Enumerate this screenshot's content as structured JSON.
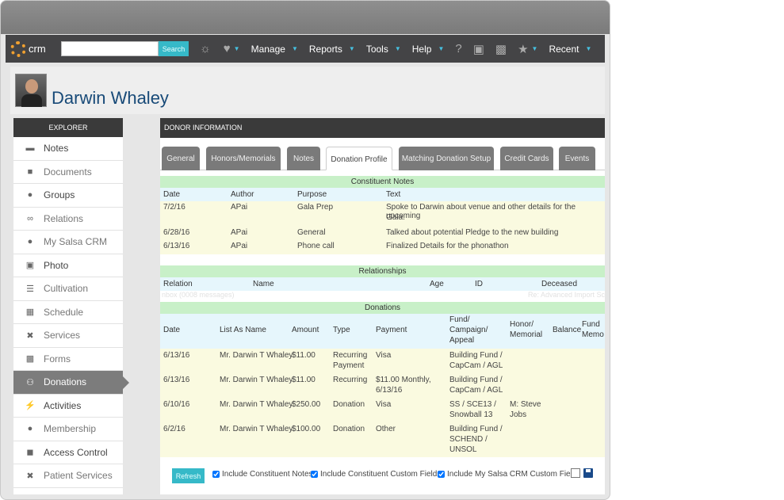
{
  "nav": {
    "logo_text": "crm",
    "search_placeholder": "",
    "search_button": "Search",
    "items": [
      "Manage",
      "Reports",
      "Tools",
      "Help",
      "Recent"
    ]
  },
  "person": {
    "name": "Darwin Whaley"
  },
  "explorer": {
    "title": "EXPLORER",
    "items": [
      {
        "label": "Notes",
        "icon": "notes-icon"
      },
      {
        "label": "Documents",
        "icon": "folder-icon"
      },
      {
        "label": "Groups",
        "icon": "groups-icon"
      },
      {
        "label": "Relations",
        "icon": "link-icon"
      },
      {
        "label": "My Salsa CRM",
        "icon": "user-settings-icon"
      },
      {
        "label": "Photo",
        "icon": "photo-icon"
      },
      {
        "label": "Cultivation",
        "icon": "cultivation-icon"
      },
      {
        "label": "Schedule",
        "icon": "calendar-icon"
      },
      {
        "label": "Services",
        "icon": "tools-icon"
      },
      {
        "label": "Forms",
        "icon": "forms-icon"
      },
      {
        "label": "Donations",
        "icon": "donations-icon"
      },
      {
        "label": "Activities",
        "icon": "bolt-icon"
      },
      {
        "label": "Membership",
        "icon": "membership-icon"
      },
      {
        "label": "Access Control",
        "icon": "lock-icon"
      },
      {
        "label": "Patient Services",
        "icon": "tools-icon"
      }
    ]
  },
  "main": {
    "title": "DONOR INFORMATION",
    "tabs": [
      "General",
      "Honors/Memorials",
      "Notes",
      "Donation Profile",
      "Matching Donation Setup",
      "Credit Cards",
      "Events"
    ],
    "active_tab": "Donation Profile"
  },
  "constituent_notes": {
    "title": "Constituent Notes",
    "headers": [
      "Date",
      "Author",
      "Purpose",
      "Text"
    ],
    "rows": [
      [
        "7/2/16",
        "APai",
        "Gala Prep",
        "Spoke to Darwin about venue and other details for the upcoming",
        "Gala."
      ],
      [
        "6/28/16",
        "APai",
        "General",
        "Talked about potential Pledge to the new building",
        ""
      ],
      [
        "6/13/16",
        "APai",
        "Phone call",
        "Finalized Details for the phonathon",
        ""
      ]
    ]
  },
  "relationships": {
    "title": "Relationships",
    "headers": [
      "Relation",
      "Name",
      "Age",
      "ID",
      "Deceased"
    ]
  },
  "ghost": {
    "left": "nbox (0008 messages)",
    "right": "Re: Advanced Import Sc"
  },
  "donations": {
    "title": "Donations",
    "headers": {
      "date": "Date",
      "list_as": "List As Name",
      "amount": "Amount",
      "type": "Type",
      "payment": "Payment",
      "fund1": "Fund/",
      "fund2": "Campaign/",
      "fund3": "Appeal",
      "honor1": "Honor/",
      "honor2": "Memorial",
      "balance": "Balance",
      "fm1": "Fund",
      "fm2": "Memo"
    },
    "rows": [
      {
        "date": "6/13/16",
        "name": "Mr. Darwin T Whaley",
        "amount": "$11.00",
        "type1": "Recurring",
        "type2": "Payment",
        "pay1": "Visa",
        "pay2": "",
        "f1": "Building Fund /",
        "f2": "CapCam / AGL",
        "f3": "",
        "h1": "",
        "h2": ""
      },
      {
        "date": "6/13/16",
        "name": "Mr. Darwin T Whaley",
        "amount": "$11.00",
        "type1": "Recurring",
        "type2": "",
        "pay1": "$11.00 Monthly,",
        "pay2": "6/13/16",
        "f1": "Building Fund /",
        "f2": "CapCam / AGL",
        "f3": "",
        "h1": "",
        "h2": ""
      },
      {
        "date": "6/10/16",
        "name": "Mr. Darwin T Whaley",
        "amount": "$250.00",
        "type1": "Donation",
        "type2": "",
        "pay1": "Visa",
        "pay2": "",
        "f1": "SS / SCE13 /",
        "f2": "Snowball 13",
        "f3": "",
        "h1": "M: Steve",
        "h2": "Jobs"
      },
      {
        "date": "6/2/16",
        "name": "Mr. Darwin T Whaley",
        "amount": "$100.00",
        "type1": "Donation",
        "type2": "",
        "pay1": "Other",
        "pay2": "",
        "f1": "Building Fund /",
        "f2": "SCHEND /",
        "f3": "UNSOL",
        "h1": "",
        "h2": ""
      }
    ]
  },
  "footer": {
    "refresh": "Refresh",
    "checks": [
      "Include Constituent Notes",
      "Include Constituent Custom Fields",
      "Include My Salsa CRM Custom Fields"
    ]
  }
}
